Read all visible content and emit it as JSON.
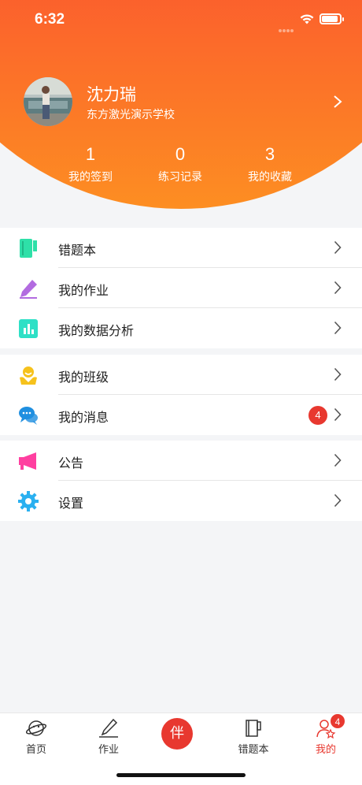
{
  "status_bar": {
    "time": "6:32"
  },
  "profile": {
    "name": "沈力瑞",
    "school": "东方激光演示学校"
  },
  "stats": [
    {
      "value": "1",
      "label": "我的签到"
    },
    {
      "value": "0",
      "label": "练习记录"
    },
    {
      "value": "3",
      "label": "我的收藏"
    }
  ],
  "menu": {
    "group1": [
      {
        "label": "错题本",
        "icon": "notebook-icon",
        "color": "#2ee0a8"
      },
      {
        "label": "我的作业",
        "icon": "pencil-icon",
        "color": "#b26be0"
      },
      {
        "label": "我的数据分析",
        "icon": "bar-chart-icon",
        "color": "#2ee0c6"
      }
    ],
    "group2": [
      {
        "label": "我的班级",
        "icon": "class-people-icon",
        "color": "#f6c21c"
      },
      {
        "label": "我的消息",
        "icon": "chat-bubbles-icon",
        "color": "#1f8fe0",
        "badge": "4"
      }
    ],
    "group3": [
      {
        "label": "公告",
        "icon": "megaphone-icon",
        "color": "#ff3fa0"
      },
      {
        "label": "设置",
        "icon": "gear-icon",
        "color": "#2ab0f0"
      }
    ]
  },
  "tabbar": {
    "tabs": [
      {
        "label": "首页",
        "icon": "planet-icon"
      },
      {
        "label": "作业",
        "icon": "pen-icon"
      },
      {
        "label": "伴",
        "icon": "companion-button"
      },
      {
        "label": "错题本",
        "icon": "book-icon"
      },
      {
        "label": "我的",
        "icon": "user-icon",
        "active": true
      }
    ],
    "mine_badge": "4"
  },
  "colors": {
    "accent": "#e8382f",
    "header_top": "#f8303a",
    "header_bottom": "#fd8e22"
  }
}
